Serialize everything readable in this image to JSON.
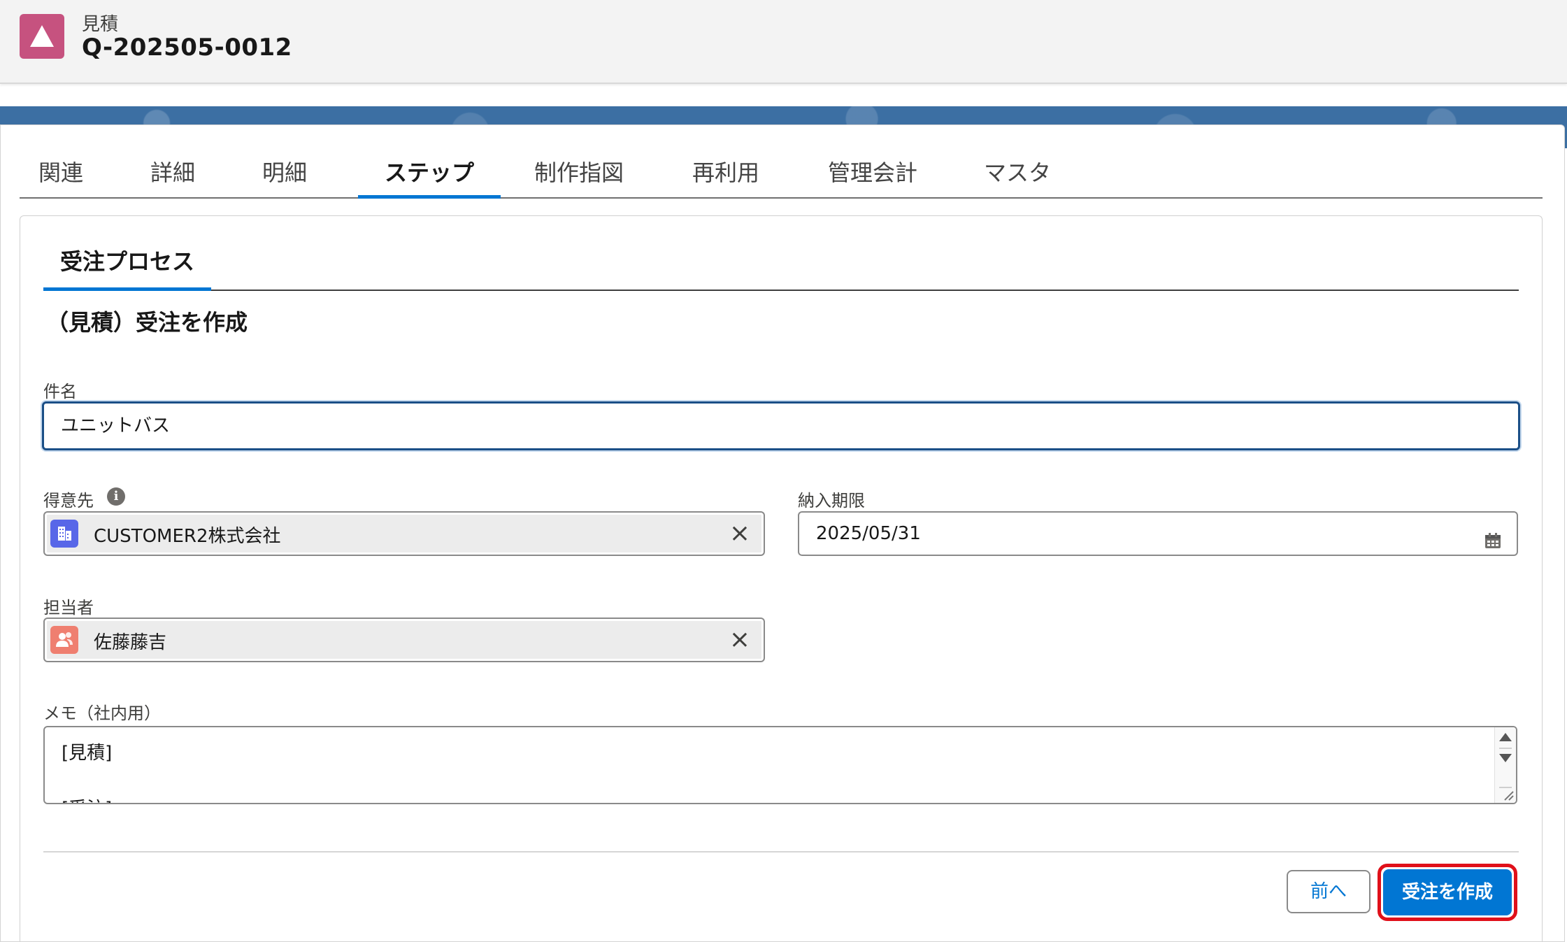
{
  "header": {
    "object_type": "見積",
    "record_name": "Q-202505-0012",
    "icon": "triangle-icon",
    "icon_color": "#c6527f"
  },
  "tabs": [
    {
      "label": "関連",
      "active": false
    },
    {
      "label": "詳細",
      "active": false
    },
    {
      "label": "明細",
      "active": false
    },
    {
      "label": "ステップ",
      "active": true
    },
    {
      "label": "制作指図",
      "active": false
    },
    {
      "label": "再利用",
      "active": false
    },
    {
      "label": "管理会計",
      "active": false
    },
    {
      "label": "マスタ",
      "active": false
    }
  ],
  "subtab": {
    "label": "受注プロセス"
  },
  "form": {
    "title": "（見積）受注を作成",
    "subject": {
      "label": "件名",
      "value": "ユニットバス"
    },
    "customer": {
      "label": "得意先",
      "value": "CUSTOMER2株式会社",
      "icon": "account-icon",
      "icon_color": "#5867e8"
    },
    "deadline": {
      "label": "納入期限",
      "value": "2025/05/31",
      "icon": "calendar-icon"
    },
    "owner": {
      "label": "担当者",
      "value": "佐藤藤吉",
      "icon": "user-icon",
      "icon_color": "#ef7f70"
    },
    "memo": {
      "label": "メモ（社内用）",
      "lines": [
        "[見積]",
        "[受注]"
      ]
    }
  },
  "buttons": {
    "previous": "前へ",
    "create_order": "受注を作成"
  },
  "colors": {
    "brand": "#0176d3",
    "highlight": "#e0101a"
  }
}
